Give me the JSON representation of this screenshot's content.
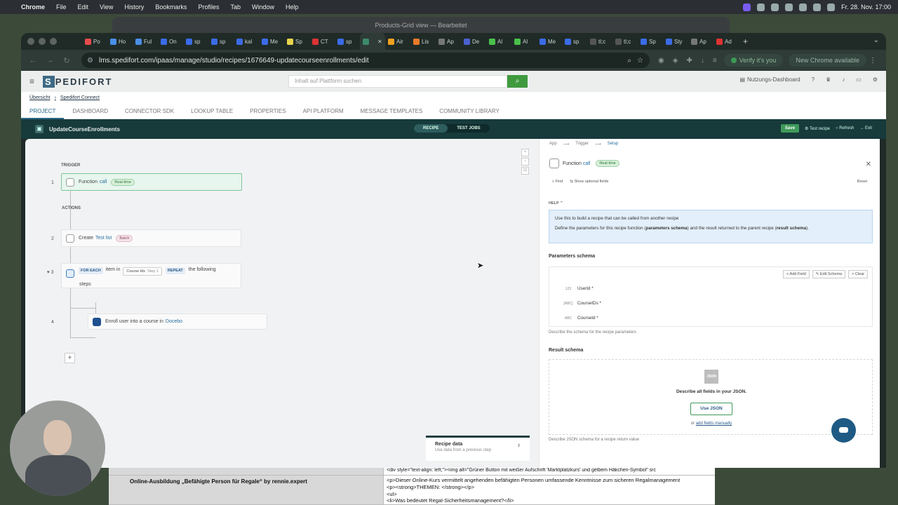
{
  "menubar": {
    "apple": "",
    "app": "Chrome",
    "items": [
      "File",
      "Edit",
      "View",
      "History",
      "Bookmarks",
      "Profiles",
      "Tab",
      "Window",
      "Help"
    ],
    "datetime": "Fr. 28. Nov.  17:00"
  },
  "bg_window_title": "Products-Grid view — Bearbeitet",
  "tabs": [
    {
      "label": "Po",
      "color": "#e54b4b"
    },
    {
      "label": "Ho",
      "color": "#4a8fe7"
    },
    {
      "label": "Ful",
      "color": "#4a8fe7"
    },
    {
      "label": "On",
      "color": "#3b6be7"
    },
    {
      "label": "sp",
      "color": "#3b6be7"
    },
    {
      "label": "sp",
      "color": "#3b6be7"
    },
    {
      "label": "kal",
      "color": "#3b6be7"
    },
    {
      "label": "Me",
      "color": "#3b6be7"
    },
    {
      "label": "Sp",
      "color": "#e8d44d"
    },
    {
      "label": "CT",
      "color": "#d33"
    },
    {
      "label": "sp",
      "color": "#3b6be7"
    },
    {
      "label": "",
      "color": "#3c8a6a"
    },
    {
      "label": "Air",
      "color": "#f0a020"
    },
    {
      "label": "Lis",
      "color": "#e87a2a"
    },
    {
      "label": "Ap",
      "color": "#777"
    },
    {
      "label": "De",
      "color": "#4a60d0"
    },
    {
      "label": "Al",
      "color": "#4ac04a"
    },
    {
      "label": "Al",
      "color": "#4ac04a"
    },
    {
      "label": "Me",
      "color": "#3b6be7"
    },
    {
      "label": "sp",
      "color": "#3b6be7"
    },
    {
      "label": "tl;c",
      "color": "#555"
    },
    {
      "label": "tl;c",
      "color": "#555"
    },
    {
      "label": "Sp",
      "color": "#3b6be7"
    },
    {
      "label": "Sty",
      "color": "#3b6be7"
    },
    {
      "label": "Ap",
      "color": "#777"
    },
    {
      "label": "Ad",
      "color": "#d33"
    }
  ],
  "tab_new": "+",
  "url": "lms.spedifort.com/ipaas/manage/studio/recipes/1676649-updatecourseenrollments/edit",
  "verify_label": "Verify it's you",
  "new_chrome_label": "New Chrome available",
  "app": {
    "logo": "PEDIFORT",
    "logo_s": "S",
    "search_placeholder": "Inhalt auf Plattform suchen",
    "dashboard_label": "Nutzungs-Dashboard",
    "breadcrumb": [
      "Übersicht",
      "Spedifort Connect"
    ],
    "nav_tabs": [
      "PROJECT",
      "DASHBOARD",
      "CONNECTOR SDK",
      "LOOKUP TABLE",
      "PROPERTIES",
      "API PLATFORM",
      "MESSAGE TEMPLATES",
      "COMMUNITY LIBRARY"
    ],
    "recipe_title": "UpdateCourseEnrollments",
    "view_tabs": [
      "RECIPE",
      "TEST JOBS"
    ],
    "actions": {
      "save": "Save",
      "test": "Test recipe",
      "refresh": "Refresh",
      "exit": "Exit"
    }
  },
  "canvas": {
    "trigger_label": "TRIGGER",
    "actions_label": "ACTIONS",
    "steps": [
      {
        "num": "1",
        "pre": "Function",
        "link": "call",
        "badge": "Real-time"
      },
      {
        "num": "2",
        "pre": "Create",
        "link": "Test list",
        "badge": "Batch"
      },
      {
        "num": "3",
        "foreach": "FOR EACH",
        "item_in": "item in",
        "pill": "Course Ids",
        "pill_step": "Step 1",
        "repeat": "REPEAT",
        "following": "the following",
        "steps_word": "steps"
      },
      {
        "num": "4",
        "pre": "Enroll user into a course in",
        "link": "Docebo"
      }
    ],
    "add_step": "+",
    "recipe_data_title": "Recipe data",
    "recipe_data_sub": "Use data from a previous step"
  },
  "panel": {
    "tabs": [
      "App",
      "Trigger",
      "Setup"
    ],
    "step_pre": "Function",
    "step_link": "call",
    "step_badge": "Real-time",
    "find": "Find",
    "optional": "Show optional fields",
    "reset": "Reset",
    "help_label": "HELP",
    "help_1": "Use this to build a recipe that can be called from another recipe",
    "help_2a": "Define the parameters for this recipe function (",
    "help_2b": "parameters schema",
    "help_2c": ") and the result returned to the parent recipe (",
    "help_2d": "result schema",
    "help_2e": ").",
    "params_label": "Parameters schema",
    "schema_btns": [
      "+ Add Field",
      "✎ Edit Schema",
      "× Clear"
    ],
    "fields": [
      {
        "type": "123",
        "name": "UserId *"
      },
      {
        "type": "[ABC]",
        "name": "CourseIDs *"
      },
      {
        "type": "ABC",
        "name": "CourseId *"
      }
    ],
    "params_hint": "Describe the schema for the recipe parameters",
    "result_label": "Result schema",
    "json_icon": "JSON",
    "result_desc": "Describe all fields in your JSON.",
    "use_json": "Use JSON",
    "or_text": "or",
    "add_manually": "add fields manually",
    "result_hint": "Describe JSON schema for a recipe return value"
  },
  "spreadsheet": {
    "row1_c2": "<div style=\"text-align: left;\"><img alt=\"Grüner Button mit weißer Aufschrift 'Marktplatzkurs' und gelbem Häkchen-Symbol\" src",
    "row2_c1": "Online-Ausbildung „Befähigte Person für Regale“ by rennie.expert",
    "row2_c2a": "<p>Dieser Online-Kurs vermittelt angehenden befähigten Personen umfassende Kenntnisse zum sicheren Regalmanagement",
    "row2_c2b": "<p><strong>THEMEN: </strong></p>",
    "row2_c2c": "<ul>",
    "row2_c2d": "<li>Was bedeutet Regal-Sicherheitsmanagement?</li>"
  }
}
